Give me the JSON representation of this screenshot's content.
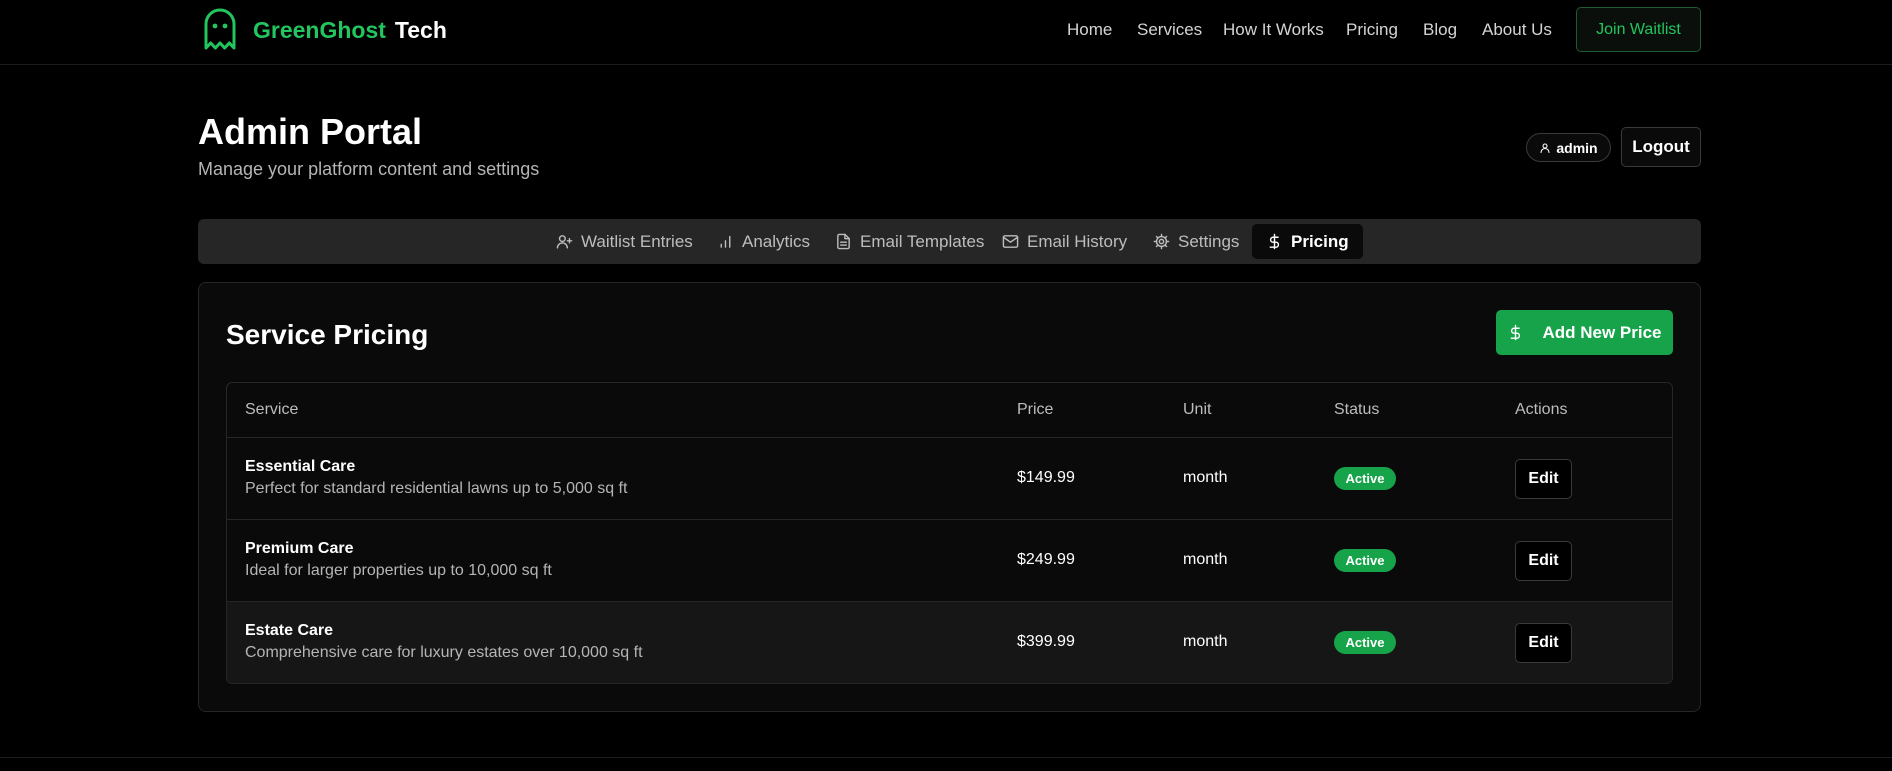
{
  "brand": {
    "green": "GreenGhost",
    "white": "Tech",
    "accent_color": "#22c55e"
  },
  "nav": {
    "links": [
      "Home",
      "Services",
      "How It Works",
      "Pricing",
      "Blog",
      "About Us"
    ],
    "cta": "Join Waitlist"
  },
  "header": {
    "title": "Admin Portal",
    "subtitle": "Manage your platform content and settings",
    "user": "admin",
    "logout": "Logout"
  },
  "tabs": [
    {
      "label": "Waitlist Entries",
      "icon": "user-plus-icon"
    },
    {
      "label": "Analytics",
      "icon": "bar-chart-icon"
    },
    {
      "label": "Email Templates",
      "icon": "file-text-icon"
    },
    {
      "label": "Email History",
      "icon": "mail-icon"
    },
    {
      "label": "Settings",
      "icon": "gear-icon"
    },
    {
      "label": "Pricing",
      "icon": "dollar-icon",
      "active": true
    }
  ],
  "pricing": {
    "title": "Service Pricing",
    "add_button": "Add New Price",
    "columns": [
      "Service",
      "Price",
      "Unit",
      "Status",
      "Actions"
    ],
    "rows": [
      {
        "name": "Essential Care",
        "description": "Perfect for standard residential lawns up to 5,000 sq ft",
        "price": "$149.99",
        "unit": "month",
        "status": "Active",
        "action": "Edit"
      },
      {
        "name": "Premium Care",
        "description": "Ideal for larger properties up to 10,000 sq ft",
        "price": "$249.99",
        "unit": "month",
        "status": "Active",
        "action": "Edit"
      },
      {
        "name": "Estate Care",
        "description": "Comprehensive care for luxury estates over 10,000 sq ft",
        "price": "$399.99",
        "unit": "month",
        "status": "Active",
        "action": "Edit"
      }
    ],
    "status_color": "#16a34a"
  }
}
